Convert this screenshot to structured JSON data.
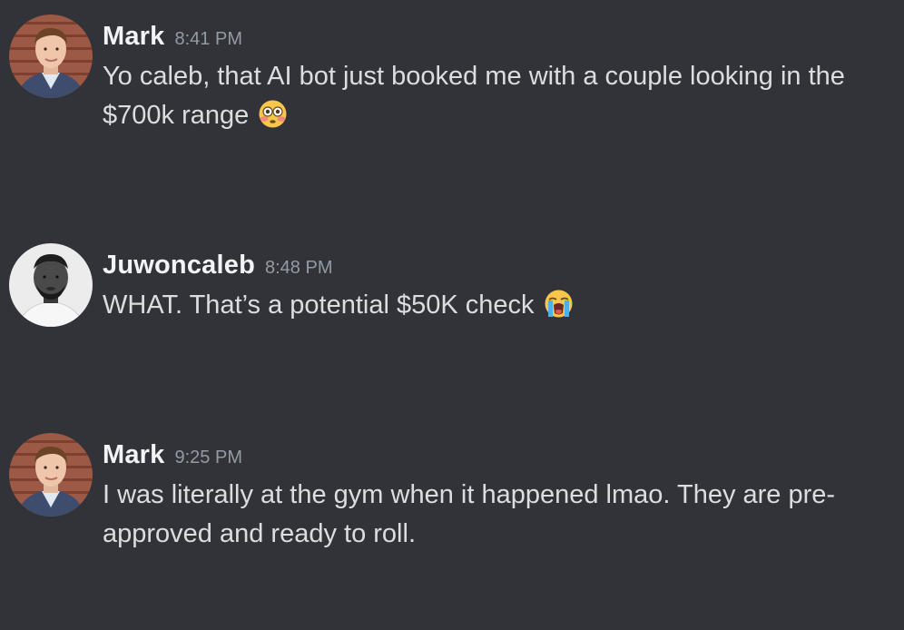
{
  "messages": [
    {
      "author": "Mark",
      "time": "8:41 PM",
      "text": "Yo caleb, that AI bot just booked me with a couple looking in the $700k range",
      "emoji": "flushed-face",
      "avatar": "mark-photo"
    },
    {
      "author": "Juwoncaleb",
      "time": "8:48 PM",
      "text": "WHAT. That’s a potential $50K check",
      "emoji": "loudly-crying-face",
      "avatar": "juwoncaleb-photo"
    },
    {
      "author": "Mark",
      "time": "9:25 PM",
      "text": "I was literally at the gym when it happened lmao. They are pre-approved and ready to roll.",
      "emoji": null,
      "avatar": "mark-photo"
    }
  ],
  "theme": {
    "background": "#313338",
    "username_color": "#f2f3f5",
    "timestamp_color": "#949ba4",
    "text_color": "#dbdee1"
  }
}
